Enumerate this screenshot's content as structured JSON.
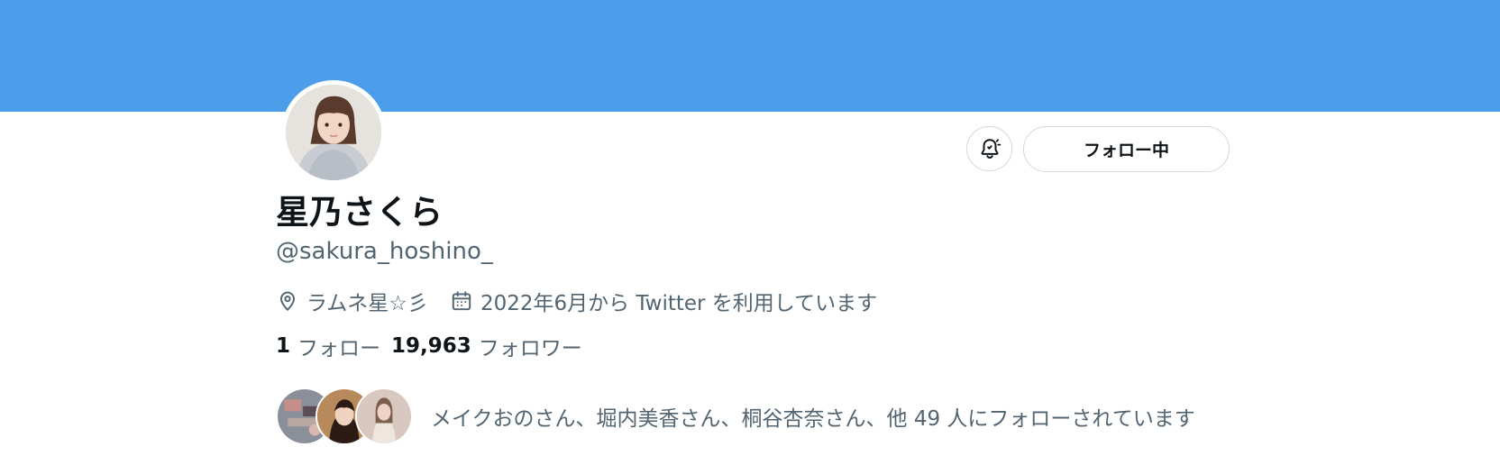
{
  "profile": {
    "display_name": "星乃さくら",
    "handle": "@sakura_hoshino_",
    "location": "ラムネ星☆彡",
    "joined": "2022年6月から Twitter を利用しています"
  },
  "actions": {
    "follow_label": "フォロー中"
  },
  "stats": {
    "following_count": "1",
    "following_label": "フォロー",
    "followers_count": "19,963",
    "followers_label": "フォロワー"
  },
  "followed_by": {
    "text": "メイクおのさん、堀内美香さん、桐谷杏奈さん、他 49 人にフォローされています"
  },
  "colors": {
    "banner": "#4c9eea",
    "secondary_text": "#536471",
    "primary_text": "#0f1419"
  },
  "icons": {
    "notification": "bell-check-icon",
    "location": "location-pin-icon",
    "joined": "calendar-icon"
  }
}
